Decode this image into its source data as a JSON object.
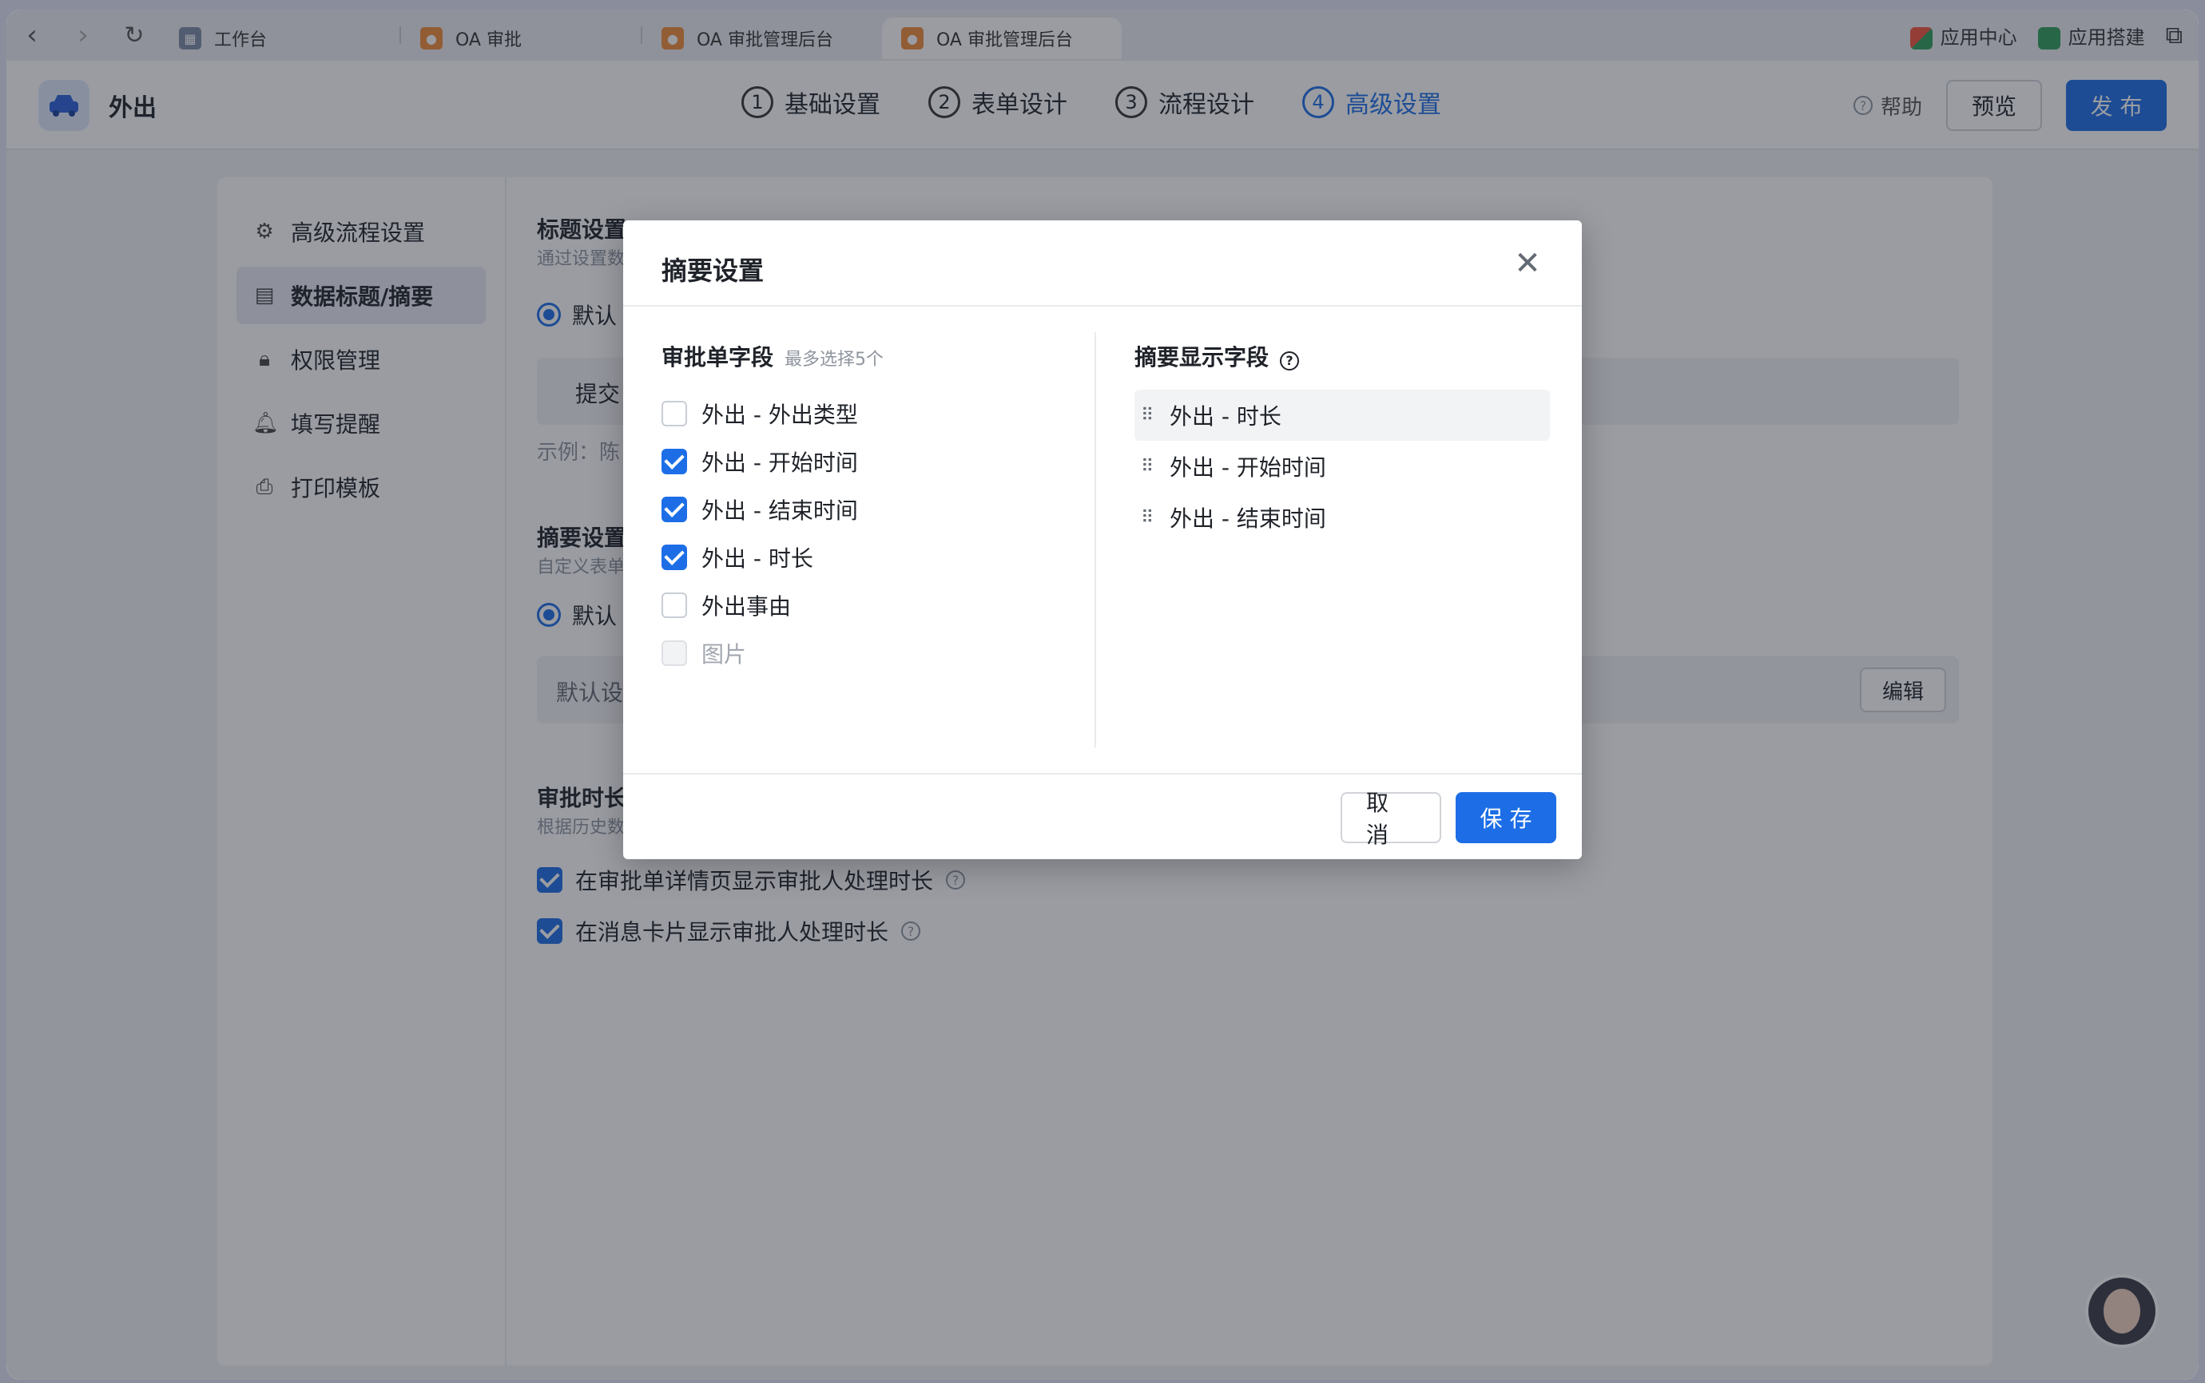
{
  "browser": {
    "tabs": [
      {
        "label": "工作台",
        "active": false
      },
      {
        "label": "OA 审批",
        "active": false
      },
      {
        "label": "OA 审批管理后台",
        "active": false
      },
      {
        "label": "OA 审批管理后台",
        "active": true
      }
    ],
    "right": {
      "app_center": "应用中心",
      "app_builder": "应用搭建"
    }
  },
  "header": {
    "app_title": "外出",
    "steps": [
      {
        "num": "1",
        "label": "基础设置"
      },
      {
        "num": "2",
        "label": "表单设计"
      },
      {
        "num": "3",
        "label": "流程设计"
      },
      {
        "num": "4",
        "label": "高级设置"
      }
    ],
    "active_step": 4,
    "help": "帮助",
    "preview": "预览",
    "publish": "发 布"
  },
  "sidebar": {
    "items": [
      {
        "label": "高级流程设置",
        "icon": "gear-icon"
      },
      {
        "label": "数据标题/摘要",
        "icon": "document-icon",
        "active": true
      },
      {
        "label": "权限管理",
        "icon": "lock-icon"
      },
      {
        "label": "填写提醒",
        "icon": "bell-icon"
      },
      {
        "label": "打印模板",
        "icon": "printer-icon"
      }
    ]
  },
  "main": {
    "title_section": {
      "title": "标题设置",
      "sub": "通过设置数",
      "radio": "默认",
      "input_prefix": "提交",
      "example": "示例：陈"
    },
    "summary_section": {
      "title": "摘要设置",
      "sub": "自定义表单",
      "radio": "默认",
      "box_text": "默认设",
      "edit": "编辑"
    },
    "duration_section": {
      "title": "审批时长",
      "sub": "根据历史数",
      "options": [
        {
          "label": "在审批单详情页显示审批人处理时长",
          "checked": true
        },
        {
          "label": "在消息卡片显示审批人处理时长",
          "checked": true
        }
      ]
    }
  },
  "modal": {
    "title": "摘要设置",
    "left_title": "审批单字段",
    "left_hint": "最多选择5个",
    "fields": [
      {
        "label": "外出 - 外出类型",
        "checked": false,
        "disabled": false
      },
      {
        "label": "外出 - 开始时间",
        "checked": true,
        "disabled": false
      },
      {
        "label": "外出 - 结束时间",
        "checked": true,
        "disabled": false
      },
      {
        "label": "外出 - 时长",
        "checked": true,
        "disabled": false
      },
      {
        "label": "外出事由",
        "checked": false,
        "disabled": false
      },
      {
        "label": "图片",
        "checked": false,
        "disabled": true
      }
    ],
    "right_title": "摘要显示字段",
    "selected": [
      "外出 - 时长",
      "外出 - 开始时间",
      "外出 - 结束时间"
    ],
    "cancel": "取 消",
    "save": "保 存"
  },
  "colors": {
    "accent": "#1d6ee6",
    "overlay": "rgba(31,35,48,0.45)"
  }
}
